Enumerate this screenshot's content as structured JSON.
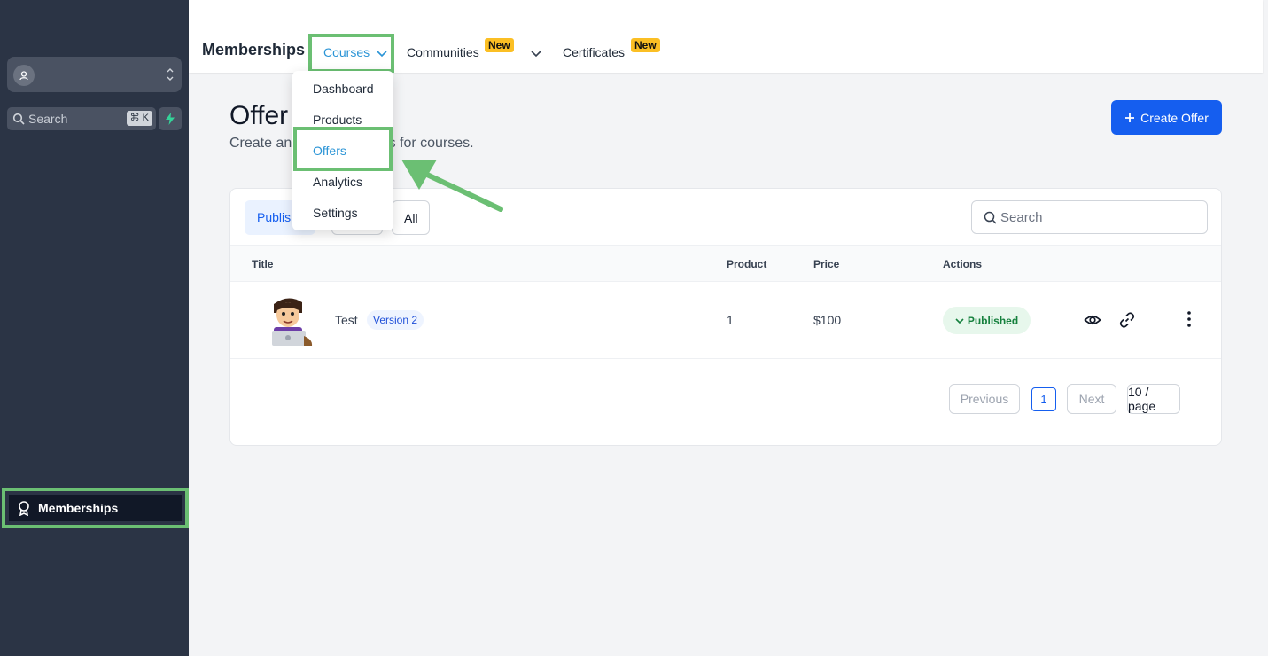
{
  "sidebar": {
    "search_placeholder": "Search",
    "search_shortcut": "⌘ K",
    "nav_memberships": "Memberships"
  },
  "topbar": {
    "title": "Memberships",
    "courses": "Courses",
    "communities": "Communities",
    "certificates": "Certificates",
    "new_badge": "New"
  },
  "dropdown": {
    "items": [
      "Dashboard",
      "Products",
      "Offers",
      "Analytics",
      "Settings"
    ]
  },
  "page": {
    "title_visible": "Offer",
    "subtitle_left": "Create an",
    "subtitle_right": "rs for courses.",
    "create_button": "Create Offer"
  },
  "filters": {
    "published": "Publish",
    "all": "All",
    "search_placeholder": "Search"
  },
  "table": {
    "headers": {
      "title": "Title",
      "product": "Product",
      "price": "Price",
      "actions": "Actions"
    },
    "rows": [
      {
        "title": "Test",
        "version": "Version 2",
        "product": "1",
        "price": "$100",
        "status": "Published"
      }
    ]
  },
  "pagination": {
    "previous": "Previous",
    "page": "1",
    "next": "Next",
    "page_size": "10 / page"
  },
  "colors": {
    "accent": "#155eef",
    "highlight": "#6bbf73",
    "sidebar_bg": "#2b3445"
  }
}
